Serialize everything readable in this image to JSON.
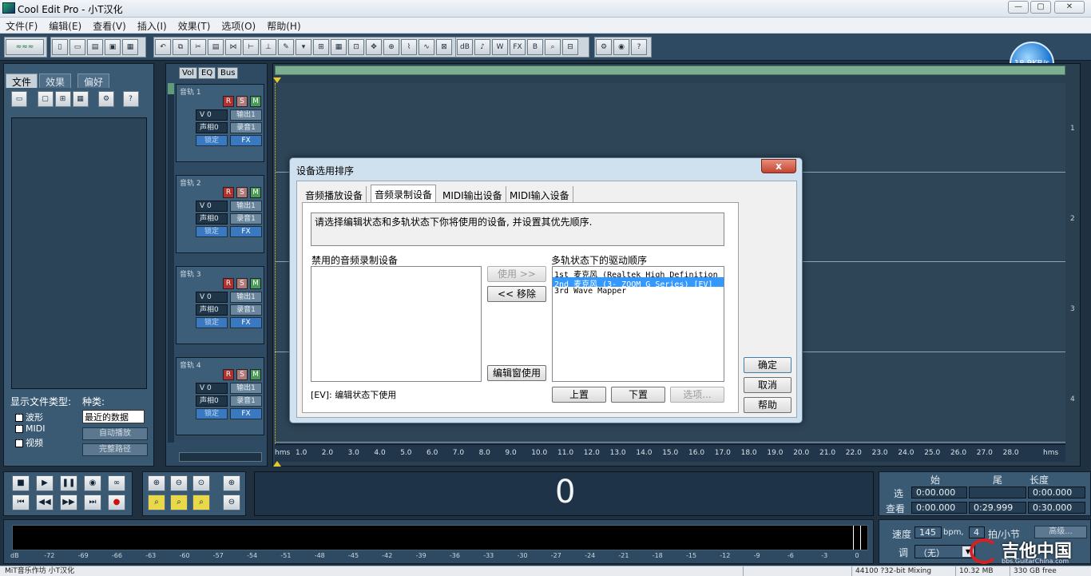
{
  "window": {
    "title": "Cool Edit Pro  - 小T汉化",
    "min": "—",
    "max": "▢",
    "close": "✕"
  },
  "menu": [
    "文件(F)",
    "编辑(E)",
    "查看(V)",
    "插入(I)",
    "效果(T)",
    "选项(O)",
    "帮助(H)"
  ],
  "network": {
    "speed": "18.9KB/s"
  },
  "organizer": {
    "tabs": [
      "文件",
      "效果",
      "偏好"
    ],
    "show_types_label": "显示文件类型:",
    "kind_label": "种类:",
    "types": [
      {
        "label": "波形",
        "checked": "X"
      },
      {
        "label": "MIDI",
        "checked": "X"
      },
      {
        "label": "视频",
        "checked": "X"
      }
    ],
    "kind_value": "最近的数据",
    "auto_play": "自动播放",
    "full_path": "完整路径"
  },
  "track_tabs": [
    "Vol",
    "EQ",
    "Bus"
  ],
  "tracks": [
    {
      "name": "音轨 1",
      "vol": "V 0",
      "pan": "声相0",
      "out": "输出1",
      "rec": "录音1",
      "lock": "锁定",
      "fx": "FX",
      "r": "R",
      "s": "S",
      "m": "M"
    },
    {
      "name": "音轨 2",
      "vol": "V 0",
      "pan": "声相0",
      "out": "输出1",
      "rec": "录音1",
      "lock": "锁定",
      "fx": "FX",
      "r": "R",
      "s": "S",
      "m": "M"
    },
    {
      "name": "音轨 3",
      "vol": "V 0",
      "pan": "声相0",
      "out": "输出1",
      "rec": "录音1",
      "lock": "锁定",
      "fx": "FX",
      "r": "R",
      "s": "S",
      "m": "M"
    },
    {
      "name": "音轨 4",
      "vol": "V 0",
      "pan": "声相0",
      "out": "输出1",
      "rec": "录音1",
      "lock": "锁定",
      "fx": "FX",
      "r": "R",
      "s": "S",
      "m": "M"
    }
  ],
  "lane_numbers": [
    "1",
    "2",
    "3",
    "4"
  ],
  "ruler": {
    "start": "hms",
    "end": "hms",
    "ticks": [
      "1.0",
      "2.0",
      "3.0",
      "4.0",
      "5.0",
      "6.0",
      "7.0",
      "8.0",
      "9.0",
      "10.0",
      "11.0",
      "12.0",
      "13.0",
      "14.0",
      "15.0",
      "16.0",
      "17.0",
      "18.0",
      "19.0",
      "20.0",
      "21.0",
      "22.0",
      "23.0",
      "24.0",
      "25.0",
      "26.0",
      "27.0",
      "28.0"
    ]
  },
  "time_display": "0",
  "selection": {
    "col_start": "始",
    "col_end": "尾",
    "col_length": "长度",
    "row_select": "选",
    "row_view": "查看",
    "sel_start": "0:00.000",
    "sel_end": "",
    "sel_length": "0:00.000",
    "view_start": "0:00.000",
    "view_end": "0:29.999",
    "view_length": "0:30.000"
  },
  "meter": {
    "labels": [
      "dB",
      "-72",
      "-69",
      "-66",
      "-63",
      "-60",
      "-57",
      "-54",
      "-51",
      "-48",
      "-45",
      "-42",
      "-39",
      "-36",
      "-33",
      "-30",
      "-27",
      "-24",
      "-21",
      "-18",
      "-15",
      "-12",
      "-9",
      "-6",
      "-3",
      "0"
    ]
  },
  "tempo": {
    "speed_label": "速度",
    "speed": "145",
    "bpm": "bpm,",
    "beats": "4",
    "beats_label": "拍/小节",
    "advanced": "高级...",
    "key_label": "调",
    "key": "（无）"
  },
  "status": {
    "left": "MiT音乐作坊 小T汉化",
    "format": "44100 ?32-bit Mixing",
    "mem": "10.32 MB",
    "free": "330 GB free"
  },
  "watermark": {
    "big": "吉他中国",
    "small": "bbs.GuitarChina.com"
  },
  "dialog": {
    "title": "设备选用排序",
    "close": "x",
    "tabs": [
      "音频播放设备",
      "音频录制设备",
      "MIDI输出设备",
      "MIDI输入设备"
    ],
    "description": "请选择编辑状态和多轨状态下你将使用的设备, 并设置其优先顺序.",
    "disabled_label": "禁用的音频录制设备",
    "order_label": "多轨状态下的驱动顺序",
    "use_btn": "使用 >>",
    "remove_btn": "<< 移除",
    "editor_use_btn": "编辑窗使用",
    "devices": [
      "1st  麦克风 (Realtek High Definition",
      "2nd  麦克风 (3- ZOOM G Series) [EV]",
      "3rd  Wave Mapper"
    ],
    "ev_note": "[EV]: 编辑状态下使用",
    "up_btn": "上置",
    "down_btn": "下置",
    "options_btn": "选项...",
    "ok_btn": "确定",
    "cancel_btn": "取消",
    "help_btn": "帮助"
  }
}
